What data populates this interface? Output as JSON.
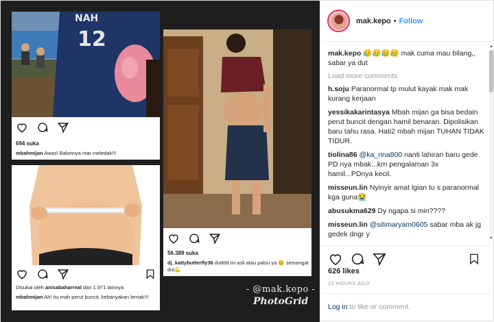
{
  "post": {
    "username": "mak.kepo",
    "follow_label": "Follow",
    "dot": "•",
    "caption_user": "mak.kepo",
    "caption_text": "😥😥😥😥 mak cuma mau bilang,, sabar ya dut",
    "load_more": "Load more comments",
    "comments": [
      {
        "user": "h.soju",
        "text": "Paranormal tp mulut kayak mak mak kurang kerjaan"
      },
      {
        "user": "yessikakarintasya",
        "text": "Mbah mijan ga bisa bedain perut buncit dengan hamil benaran. Dipolisikan baru tahu rasa. Hati2 mbah mijan TUHAN TIDAK TIDUR."
      },
      {
        "user": "tiolina86",
        "mention": "@ka_rina800",
        "text": "nanti lahiran baru gede PD nya mbak...krn pengalaman 3x hamil...PDnya kecil."
      },
      {
        "user": "misseun.lin",
        "text": "Nyinyir amat lgian tu s paranormal kga guna😭"
      },
      {
        "user": "abusukma629",
        "text": "Dy ngapa si min????"
      },
      {
        "user": "misseun.lin",
        "mention": "@sitimaryam0605",
        "text": "sabar mba ak jg gedek dngr y"
      }
    ],
    "likes": "626 likes",
    "timestamp": "22 HOURS AGO",
    "login_link": "Log in",
    "login_text": " to like or comment."
  },
  "collage": {
    "card1": {
      "likes": "694 suka",
      "user": "mbahmijan",
      "text": "Awas! Balonnya ntar meledak!!!"
    },
    "card2": {
      "liked_by": "Disukai oleh",
      "liked_user": "anisabaharreal",
      "liked_rest": "dan 1.971 lainnya",
      "user": "mbahmijan",
      "text": "Ah! itu mah perut buncit, kebanyakan lemak!!!"
    },
    "card3": {
      "likes": "56.389 suka",
      "user": "dj_kattybutterfly36",
      "text": "dutttttt ini asli atau palsu ya 😊 semangat dut💪"
    },
    "jersey_text": "12",
    "jersey_name": "NAH",
    "watermark_handle": "- @mak.kepo -",
    "watermark_app": "PhotoGrid"
  },
  "colors": {
    "accent": "#3897f0",
    "link": "#003569",
    "muted": "#999999",
    "story_ring": "#e1306c"
  }
}
